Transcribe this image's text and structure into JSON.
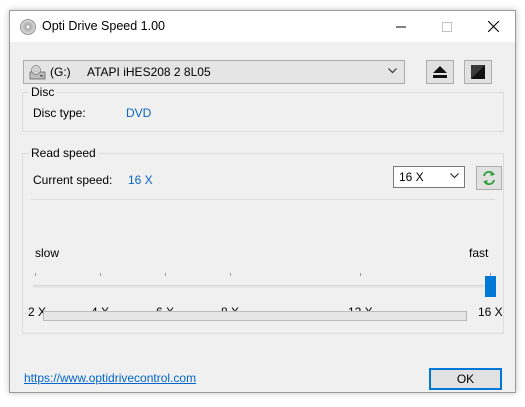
{
  "window": {
    "title": "Opti Drive Speed 1.00"
  },
  "drive": {
    "letter": "(G:)",
    "model": "ATAPI iHES208   2 8L05",
    "icon": "cd-drive-icon"
  },
  "toolbar": {
    "eject_icon": "eject-icon",
    "tray_icon": "close-tray-icon"
  },
  "disc": {
    "group_title": "Disc",
    "type_label": "Disc type:",
    "type_value": "DVD"
  },
  "read_speed": {
    "group_title": "Read speed",
    "current_label": "Current speed:",
    "current_value": "16 X",
    "selected_speed": "16 X",
    "slider": {
      "min_label": "slow",
      "max_label": "fast",
      "ticks": [
        "2 X",
        "4 X",
        "6 X",
        "8 X",
        "12 X",
        "16 X"
      ],
      "value": "16 X"
    },
    "progress": 0
  },
  "footer": {
    "link": "https://www.optidrivecontrol.com",
    "ok_label": "OK"
  },
  "colors": {
    "accent": "#0078d7",
    "value_text": "#0a64c8",
    "link": "#0066cc"
  }
}
